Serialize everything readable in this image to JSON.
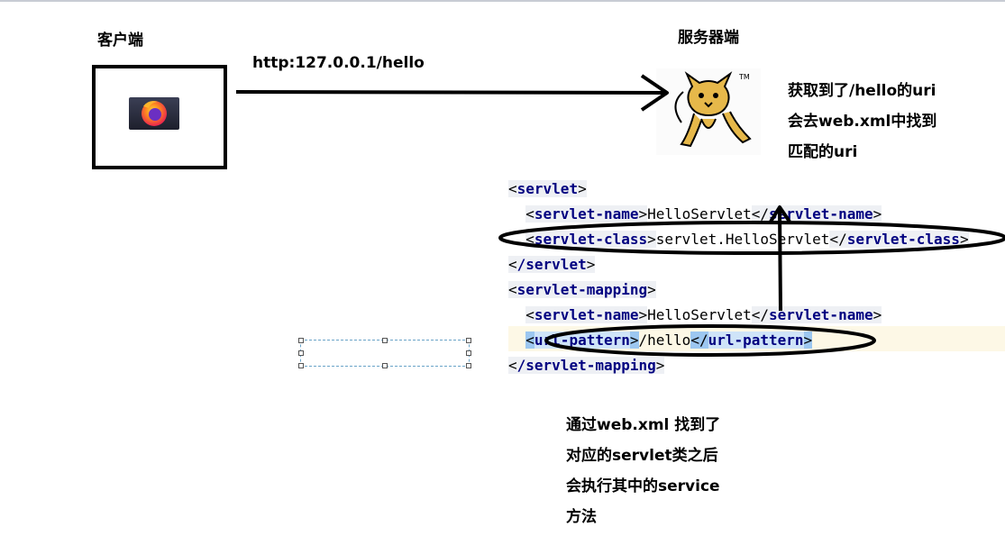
{
  "labels": {
    "client": "客户端",
    "server": "服务器端",
    "url": "http:127.0.0.1/hello"
  },
  "notes": {
    "right": [
      "获取到了/hello的uri",
      "会去web.xml中找到",
      "匹配的uri"
    ],
    "bottom": [
      "通过web.xml 找到了",
      "对应的servlet类之后",
      "会执行其中的service",
      "方法"
    ]
  },
  "code": {
    "servlet_open": "servlet",
    "servlet_name_tag": "servlet-name",
    "servlet_name_value": "HelloServlet",
    "servlet_class_tag": "servlet-class",
    "servlet_class_value": "servlet.HelloServlet",
    "servlet_close": "/servlet",
    "mapping_open": "servlet-mapping",
    "mapping_name_value": "HelloServlet",
    "url_pattern_tag": "url-pattern",
    "url_pattern_value": "/hello",
    "mapping_close": "/servlet-mapping"
  },
  "icons": {
    "browser": "firefox-icon",
    "server": "tomcat-icon"
  },
  "colors": {
    "xml_tag": "#000080",
    "selection": "#9cc7f0",
    "highlight_line": "#fdf8e6",
    "ink": "#000000"
  }
}
